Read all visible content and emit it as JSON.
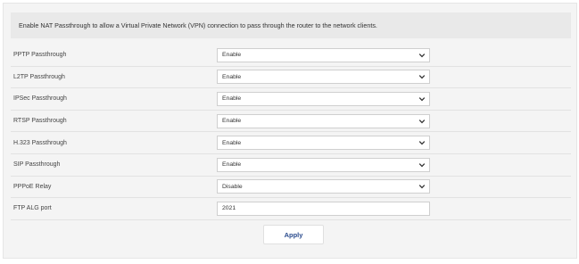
{
  "info_text": "Enable NAT Passthrough to allow a Virtual Private Network (VPN) connection to pass through the router to the network clients.",
  "settings": [
    {
      "label": "PPTP Passthrough",
      "value": "Enable"
    },
    {
      "label": "L2TP Passthrough",
      "value": "Enable"
    },
    {
      "label": "IPSec Passthrough",
      "value": "Enable"
    },
    {
      "label": "RTSP Passthrough",
      "value": "Enable"
    },
    {
      "label": "H.323 Passthrough",
      "value": "Enable"
    },
    {
      "label": "SIP Passthrough",
      "value": "Enable"
    },
    {
      "label": "PPPoE Relay",
      "value": "Disable"
    },
    {
      "label": "FTP ALG port",
      "value": "2021"
    }
  ],
  "apply_label": "Apply",
  "colors": {
    "accent": "#2a4b8d",
    "panel": "#e9e9e9",
    "background": "#f4f4f4"
  }
}
